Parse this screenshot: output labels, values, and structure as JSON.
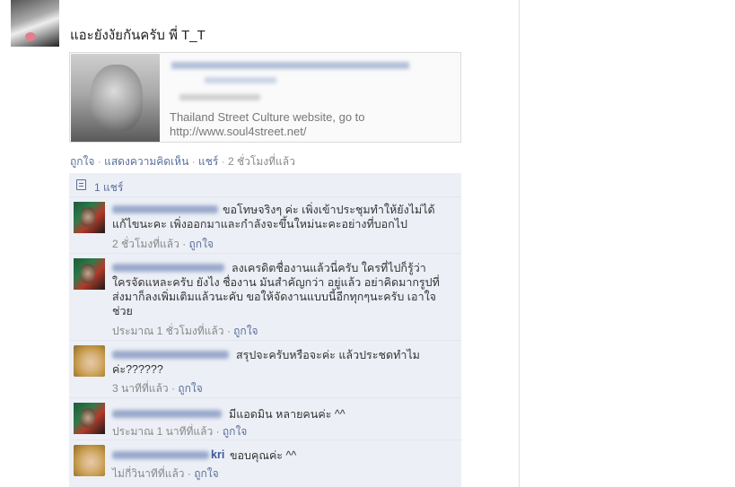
{
  "post": {
    "message": "แอะยังงัยกันครับ พี่ T_T",
    "link_card": {
      "description": "Thailand Street Culture website, go to http://www.soul4street.net/"
    },
    "actions": {
      "like": "ถูกใจ",
      "comment": "แสดงความคิดเห็น",
      "share": "แชร์",
      "timestamp": "2 ชั่วโมงที่แล้ว"
    }
  },
  "shares": {
    "label": "1 แชร์"
  },
  "comments": [
    {
      "avatar": "movie-poster-avatar",
      "name_visible": "",
      "text": "ขอโทษจริงๆ ค่ะ เพิ่งเข้าประชุมทำให้ยังไม่ได้แก้ไขนะคะ เพิ่งออกมาและกำลังจะขึ้นใหม่นะคะอย่างที่บอกไป",
      "time": "2 ชั่วโมงที่แล้ว",
      "like": "ถูกใจ"
    },
    {
      "avatar": "movie-poster-avatar",
      "name_visible": "",
      "text": "ลงเครดิตชื่องานแล้วนี่ครับ ใครที่ไปก็รู้ว่าใครจัดแหละครับ ยังไง ชื่องาน มันสำคัญกว่า อยู่แล้ว อย่าคิดมากรูปที่ส่งมาก็ลงเพิ่มเติมแล้วนะคับ ขอให้จัดงานแบบนี้อีกทุกๆนะครับ เอาใจช่วย",
      "time": "ประมาณ 1 ชั่วโมงที่แล้ว",
      "like": "ถูกใจ"
    },
    {
      "avatar": "blonde-user-avatar",
      "name_visible": "",
      "text": "สรุปจะครับหรือจะค่ะ แล้วประชดทำไมค่ะ??????",
      "time": "3 นาทีที่แล้ว",
      "like": "ถูกใจ"
    },
    {
      "avatar": "movie-poster-avatar",
      "name_visible": "",
      "text": "มีแอดมิน หลายคนค่ะ ^^",
      "time": "ประมาณ 1 นาทีที่แล้ว",
      "like": "ถูกใจ"
    },
    {
      "avatar": "blonde-user-avatar",
      "name_visible": "kri",
      "text": "ขอบคุณค่ะ ^^",
      "time": "ไม่กี่วินาทีที่แล้ว",
      "like": "ถูกใจ"
    }
  ],
  "colors": {
    "link_blue": "#3b5998",
    "meta_link": "#5a6f9c",
    "comments_bg": "#eceff5",
    "meta_gray": "#888888"
  }
}
